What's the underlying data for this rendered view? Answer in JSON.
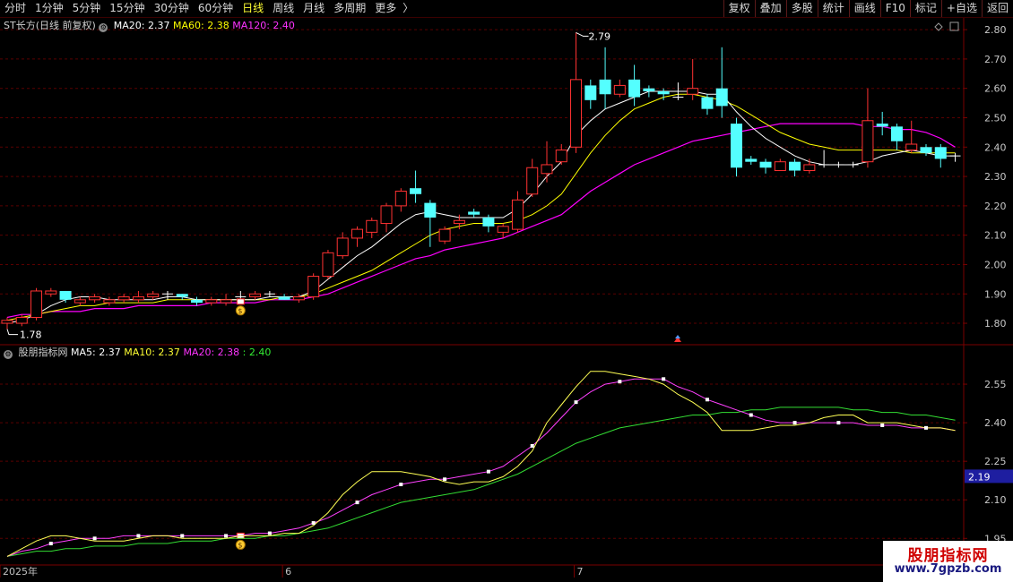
{
  "toolbar": {
    "periods": [
      {
        "label": "分时",
        "active": false
      },
      {
        "label": "1分钟",
        "active": false
      },
      {
        "label": "5分钟",
        "active": false
      },
      {
        "label": "15分钟",
        "active": false
      },
      {
        "label": "30分钟",
        "active": false
      },
      {
        "label": "60分钟",
        "active": false
      },
      {
        "label": "日线",
        "active": true
      },
      {
        "label": "周线",
        "active": false
      },
      {
        "label": "月线",
        "active": false
      },
      {
        "label": "多周期",
        "active": false
      },
      {
        "label": "更多",
        "active": false
      }
    ],
    "more_chevron": "〉",
    "buttons": [
      "复权",
      "叠加",
      "多股",
      "统计",
      "画线",
      "F10",
      "标记",
      "+自选",
      "返回"
    ]
  },
  "main_legend": {
    "stock": "ST长方(日线 前复权)",
    "ma20": "MA20: 2.37",
    "ma60": "MA60: 2.38",
    "ma120": "MA120: 2.40"
  },
  "sub_legend": {
    "name": "股朋指标网",
    "ma5": "MA5: 2.37",
    "ma10": "MA10: 2.37",
    "ma20": "MA20: 2.38",
    "extra": ": 2.40"
  },
  "price_axis": [
    "2.80",
    "2.70",
    "2.60",
    "2.50",
    "2.40",
    "2.30",
    "2.20",
    "2.10",
    "2.00",
    "1.90",
    "1.80"
  ],
  "sub_axis": [
    "2.55",
    "2.40",
    "2.25",
    "2.10",
    "1.95"
  ],
  "sub_current": "2.19",
  "annotations": {
    "high": "2.79",
    "low": "1.78",
    "bag": "$"
  },
  "time_axis": [
    "2025年",
    "6",
    "7"
  ],
  "watermark": {
    "title": "股朋指标网",
    "url": "www.7gpzb.com"
  },
  "colors": {
    "up": "#ff3232",
    "down": "#54ffff",
    "flat": "#ffffff",
    "ma20": "#ffffff",
    "ma60": "#ffff00",
    "ma120": "#ff00ff",
    "sub_ma5": "#ffff54",
    "sub_ma10": "#ff40ff",
    "sub_ma20": "#33dd33",
    "grid": "#5a0000",
    "axis": "#7a0000"
  },
  "chart_data": {
    "type": "candlestick",
    "price_range": [
      1.73,
      2.84
    ],
    "candles": [
      [
        1.8,
        1.81,
        1.78,
        1.82
      ],
      [
        1.8,
        1.82,
        1.79,
        1.83
      ],
      [
        1.82,
        1.91,
        1.81,
        1.92
      ],
      [
        1.9,
        1.91,
        1.89,
        1.92
      ],
      [
        1.91,
        1.88,
        1.87,
        1.91
      ],
      [
        1.87,
        1.88,
        1.86,
        1.89
      ],
      [
        1.88,
        1.89,
        1.87,
        1.9
      ],
      [
        1.87,
        1.88,
        1.86,
        1.89
      ],
      [
        1.88,
        1.89,
        1.87,
        1.9
      ],
      [
        1.88,
        1.89,
        1.87,
        1.91
      ],
      [
        1.89,
        1.9,
        1.88,
        1.91
      ],
      [
        1.9,
        1.9,
        1.88,
        1.91
      ],
      [
        1.9,
        1.89,
        1.88,
        1.9
      ],
      [
        1.88,
        1.87,
        1.86,
        1.89
      ],
      [
        1.87,
        1.88,
        1.86,
        1.89
      ],
      [
        1.87,
        1.88,
        1.86,
        1.9
      ],
      [
        1.89,
        1.89,
        1.88,
        1.91
      ],
      [
        1.89,
        1.9,
        1.88,
        1.91
      ],
      [
        1.9,
        1.9,
        1.89,
        1.91
      ],
      [
        1.89,
        1.88,
        1.88,
        1.9
      ],
      [
        1.88,
        1.89,
        1.87,
        1.9
      ],
      [
        1.89,
        1.96,
        1.88,
        1.97
      ],
      [
        1.96,
        2.04,
        1.95,
        2.05
      ],
      [
        2.03,
        2.09,
        2.02,
        2.11
      ],
      [
        2.09,
        2.12,
        2.06,
        2.13
      ],
      [
        2.11,
        2.15,
        2.09,
        2.16
      ],
      [
        2.14,
        2.2,
        2.11,
        2.21
      ],
      [
        2.2,
        2.25,
        2.18,
        2.26
      ],
      [
        2.26,
        2.24,
        2.21,
        2.32
      ],
      [
        2.21,
        2.16,
        2.06,
        2.22
      ],
      [
        2.08,
        2.12,
        2.07,
        2.13
      ],
      [
        2.14,
        2.15,
        2.12,
        2.17
      ],
      [
        2.18,
        2.17,
        2.16,
        2.19
      ],
      [
        2.16,
        2.13,
        2.11,
        2.17
      ],
      [
        2.11,
        2.13,
        2.09,
        2.14
      ],
      [
        2.12,
        2.22,
        2.11,
        2.25
      ],
      [
        2.24,
        2.33,
        2.23,
        2.36
      ],
      [
        2.31,
        2.34,
        2.28,
        2.42
      ],
      [
        2.35,
        2.39,
        2.34,
        2.41
      ],
      [
        2.4,
        2.63,
        2.38,
        2.79
      ],
      [
        2.61,
        2.56,
        2.53,
        2.63
      ],
      [
        2.63,
        2.58,
        2.53,
        2.74
      ],
      [
        2.58,
        2.61,
        2.57,
        2.63
      ],
      [
        2.63,
        2.57,
        2.54,
        2.68
      ],
      [
        2.6,
        2.59,
        2.57,
        2.61
      ],
      [
        2.59,
        2.58,
        2.56,
        2.6
      ],
      [
        2.57,
        2.57,
        2.56,
        2.62
      ],
      [
        2.58,
        2.6,
        2.56,
        2.7
      ],
      [
        2.57,
        2.53,
        2.51,
        2.58
      ],
      [
        2.6,
        2.54,
        2.5,
        2.74
      ],
      [
        2.48,
        2.33,
        2.3,
        2.5
      ],
      [
        2.36,
        2.35,
        2.34,
        2.37
      ],
      [
        2.35,
        2.33,
        2.31,
        2.36
      ],
      [
        2.32,
        2.35,
        2.32,
        2.36
      ],
      [
        2.35,
        2.32,
        2.3,
        2.36
      ],
      [
        2.32,
        2.34,
        2.31,
        2.36
      ],
      [
        2.34,
        2.34,
        2.33,
        2.39
      ],
      [
        2.34,
        2.34,
        2.33,
        2.35
      ],
      [
        2.34,
        2.34,
        2.33,
        2.35
      ],
      [
        2.35,
        2.49,
        2.33,
        2.6
      ],
      [
        2.48,
        2.47,
        2.44,
        2.52
      ],
      [
        2.47,
        2.42,
        2.39,
        2.48
      ],
      [
        2.39,
        2.41,
        2.38,
        2.49
      ],
      [
        2.4,
        2.38,
        2.37,
        2.41
      ],
      [
        2.4,
        2.36,
        2.33,
        2.41
      ],
      [
        2.37,
        2.37,
        2.35,
        2.38
      ]
    ],
    "ma20": [
      1.8,
      1.81,
      1.83,
      1.86,
      1.88,
      1.89,
      1.89,
      1.88,
      1.88,
      1.88,
      1.88,
      1.89,
      1.89,
      1.88,
      1.88,
      1.88,
      1.88,
      1.88,
      1.89,
      1.89,
      1.89,
      1.91,
      1.95,
      1.99,
      2.03,
      2.06,
      2.1,
      2.14,
      2.17,
      2.18,
      2.17,
      2.16,
      2.16,
      2.16,
      2.16,
      2.19,
      2.24,
      2.3,
      2.35,
      2.44,
      2.49,
      2.53,
      2.55,
      2.57,
      2.59,
      2.59,
      2.59,
      2.59,
      2.58,
      2.58,
      2.52,
      2.47,
      2.43,
      2.4,
      2.37,
      2.35,
      2.34,
      2.34,
      2.34,
      2.35,
      2.37,
      2.38,
      2.39,
      2.38,
      2.37,
      2.37
    ],
    "ma60": [
      1.81,
      1.82,
      1.83,
      1.84,
      1.85,
      1.86,
      1.86,
      1.87,
      1.87,
      1.87,
      1.87,
      1.88,
      1.88,
      1.88,
      1.88,
      1.88,
      1.88,
      1.88,
      1.88,
      1.89,
      1.89,
      1.9,
      1.92,
      1.94,
      1.96,
      1.98,
      2.01,
      2.04,
      2.07,
      2.1,
      2.12,
      2.13,
      2.14,
      2.14,
      2.14,
      2.15,
      2.17,
      2.2,
      2.24,
      2.31,
      2.38,
      2.44,
      2.49,
      2.53,
      2.55,
      2.57,
      2.58,
      2.58,
      2.57,
      2.56,
      2.54,
      2.51,
      2.48,
      2.45,
      2.43,
      2.41,
      2.4,
      2.39,
      2.39,
      2.39,
      2.39,
      2.39,
      2.38,
      2.38,
      2.38,
      2.38
    ],
    "ma120": [
      1.82,
      1.83,
      1.83,
      1.84,
      1.84,
      1.84,
      1.85,
      1.85,
      1.85,
      1.86,
      1.86,
      1.86,
      1.86,
      1.86,
      1.87,
      1.87,
      1.87,
      1.87,
      1.88,
      1.88,
      1.88,
      1.89,
      1.9,
      1.92,
      1.94,
      1.96,
      1.98,
      2.0,
      2.02,
      2.03,
      2.05,
      2.06,
      2.07,
      2.08,
      2.09,
      2.11,
      2.13,
      2.15,
      2.17,
      2.21,
      2.25,
      2.28,
      2.31,
      2.34,
      2.36,
      2.38,
      2.4,
      2.42,
      2.43,
      2.44,
      2.45,
      2.46,
      2.47,
      2.48,
      2.48,
      2.48,
      2.48,
      2.48,
      2.48,
      2.47,
      2.47,
      2.46,
      2.46,
      2.45,
      2.43,
      2.4
    ],
    "sub_range": [
      1.85,
      2.7
    ],
    "sub_ma5": [
      1.88,
      1.91,
      1.94,
      1.96,
      1.96,
      1.95,
      1.94,
      1.94,
      1.94,
      1.95,
      1.96,
      1.96,
      1.95,
      1.95,
      1.95,
      1.95,
      1.96,
      1.96,
      1.96,
      1.97,
      1.97,
      2.0,
      2.05,
      2.12,
      2.17,
      2.21,
      2.21,
      2.21,
      2.2,
      2.19,
      2.17,
      2.16,
      2.17,
      2.17,
      2.19,
      2.23,
      2.29,
      2.4,
      2.47,
      2.54,
      2.6,
      2.6,
      2.59,
      2.58,
      2.57,
      2.55,
      2.51,
      2.48,
      2.44,
      2.37,
      2.37,
      2.37,
      2.38,
      2.39,
      2.39,
      2.4,
      2.42,
      2.43,
      2.43,
      2.4,
      2.4,
      2.4,
      2.39,
      2.38,
      2.38,
      2.37
    ],
    "sub_ma10": [
      1.88,
      1.9,
      1.91,
      1.93,
      1.94,
      1.95,
      1.95,
      1.95,
      1.96,
      1.96,
      1.96,
      1.96,
      1.96,
      1.96,
      1.96,
      1.96,
      1.96,
      1.97,
      1.97,
      1.98,
      1.99,
      2.01,
      2.03,
      2.06,
      2.09,
      2.12,
      2.14,
      2.16,
      2.17,
      2.18,
      2.18,
      2.19,
      2.2,
      2.21,
      2.23,
      2.27,
      2.31,
      2.36,
      2.42,
      2.48,
      2.52,
      2.55,
      2.56,
      2.57,
      2.57,
      2.57,
      2.54,
      2.52,
      2.49,
      2.47,
      2.45,
      2.43,
      2.41,
      2.4,
      2.4,
      2.4,
      2.4,
      2.4,
      2.4,
      2.39,
      2.39,
      2.39,
      2.38,
      2.38,
      2.38,
      2.37
    ],
    "sub_ma20": [
      1.88,
      1.89,
      1.9,
      1.9,
      1.91,
      1.91,
      1.92,
      1.92,
      1.92,
      1.93,
      1.93,
      1.93,
      1.94,
      1.94,
      1.94,
      1.95,
      1.95,
      1.95,
      1.96,
      1.96,
      1.97,
      1.98,
      1.99,
      2.01,
      2.03,
      2.05,
      2.07,
      2.09,
      2.1,
      2.11,
      2.12,
      2.13,
      2.14,
      2.16,
      2.18,
      2.2,
      2.23,
      2.26,
      2.29,
      2.32,
      2.34,
      2.36,
      2.38,
      2.39,
      2.4,
      2.41,
      2.42,
      2.43,
      2.43,
      2.44,
      2.44,
      2.45,
      2.45,
      2.46,
      2.46,
      2.46,
      2.46,
      2.46,
      2.45,
      2.45,
      2.44,
      2.44,
      2.43,
      2.43,
      2.42,
      2.41
    ]
  }
}
